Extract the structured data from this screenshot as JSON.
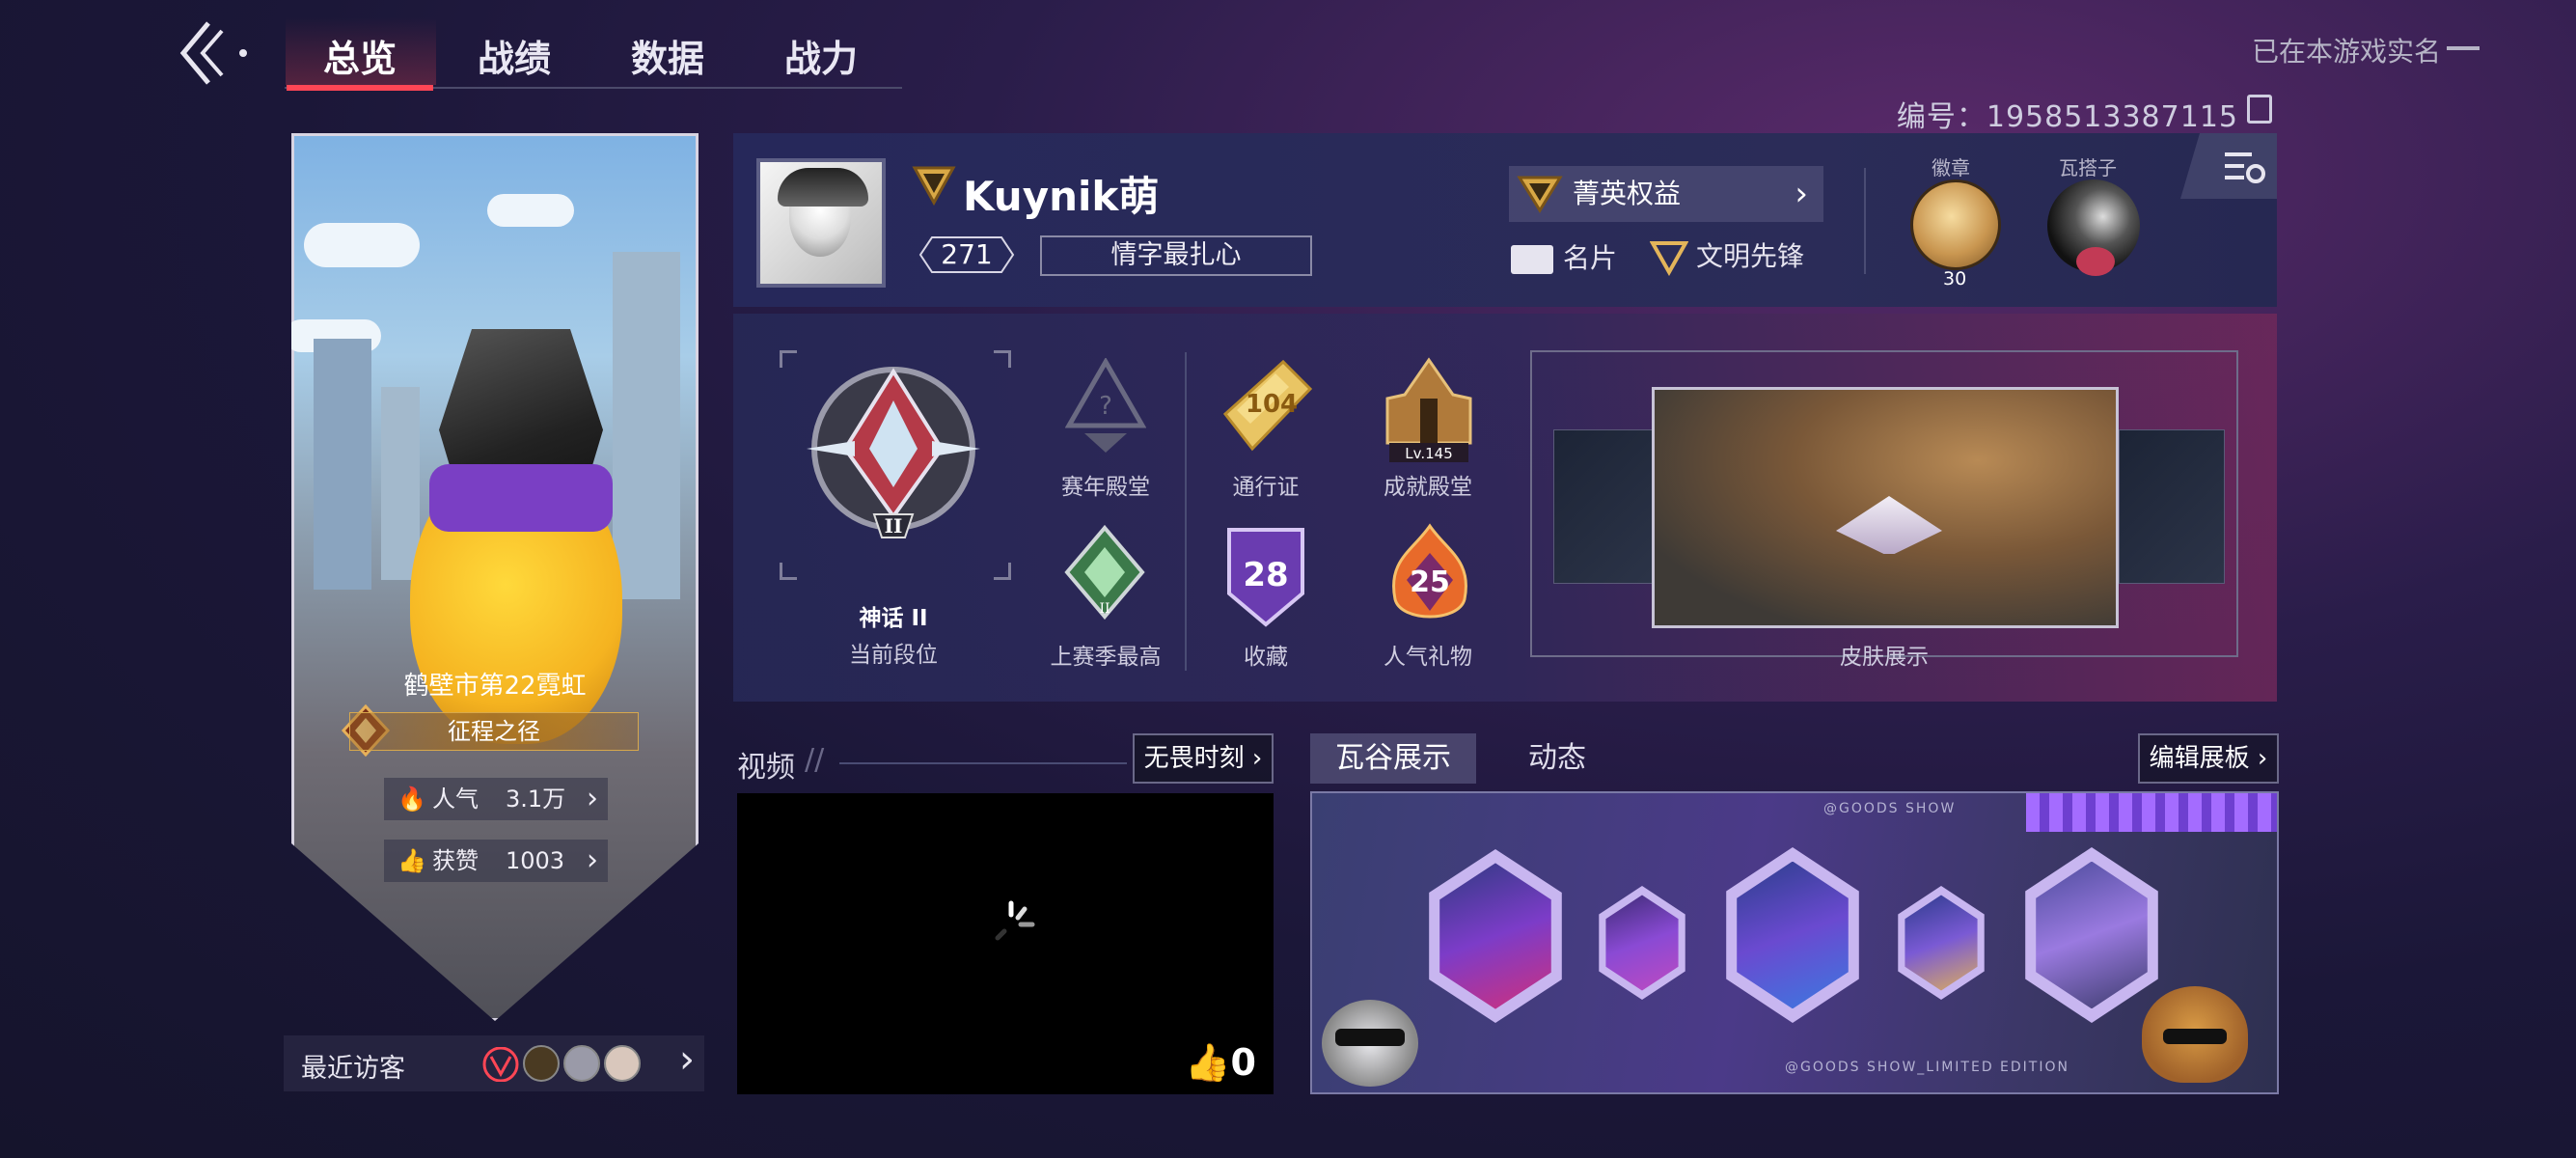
{
  "nav": {
    "tabs": [
      {
        "label": "总览",
        "active": true
      },
      {
        "label": "战绩",
        "active": false
      },
      {
        "label": "数据",
        "active": false
      },
      {
        "label": "战力",
        "active": false
      }
    ],
    "realname_text": "已在本游戏实名",
    "player_id": "编号：1958513387115"
  },
  "card": {
    "region": "鹤壁市第22霓虹",
    "rank_banner": "征程之径",
    "popularity_label": "人气",
    "popularity_value": "3.1万",
    "likes_label": "获赞",
    "likes_value": "1003",
    "visitors_label": "最近访客"
  },
  "profile": {
    "name": "Kuynik萌",
    "level": "271",
    "title": "情字最扎心",
    "elite_label": "菁英权益",
    "namecard_label": "名片",
    "pioneer_label": "文明先锋",
    "medal_label": "徽章",
    "medal_count": "30",
    "buddy_label": "瓦搭子"
  },
  "achievements": {
    "rank_name": "神话 II",
    "rank_caption": "当前段位",
    "hall_label": "赛年殿堂",
    "pass_label": "通行证",
    "pass_value": "104",
    "achievement_hall_label": "成就殿堂",
    "achievement_level": "Lv.145",
    "last_season_label": "上赛季最高",
    "collection_label": "收藏",
    "collection_value": "28",
    "gift_label": "人气礼物",
    "gift_value": "25",
    "skin_label": "皮肤展示"
  },
  "video": {
    "title": "视频",
    "link_label": "无畏时刻",
    "likes": "0"
  },
  "showcase": {
    "tabs": [
      {
        "label": "瓦谷展示",
        "active": true
      },
      {
        "label": "动态",
        "active": false
      }
    ],
    "edit_label": "编辑展板",
    "caption_top": "@GOODS SHOW",
    "caption_bottom": "@GOODS SHOW_LIMITED EDITION"
  },
  "colors": {
    "accent": "#ff4655",
    "gold": "#d7a84c"
  }
}
